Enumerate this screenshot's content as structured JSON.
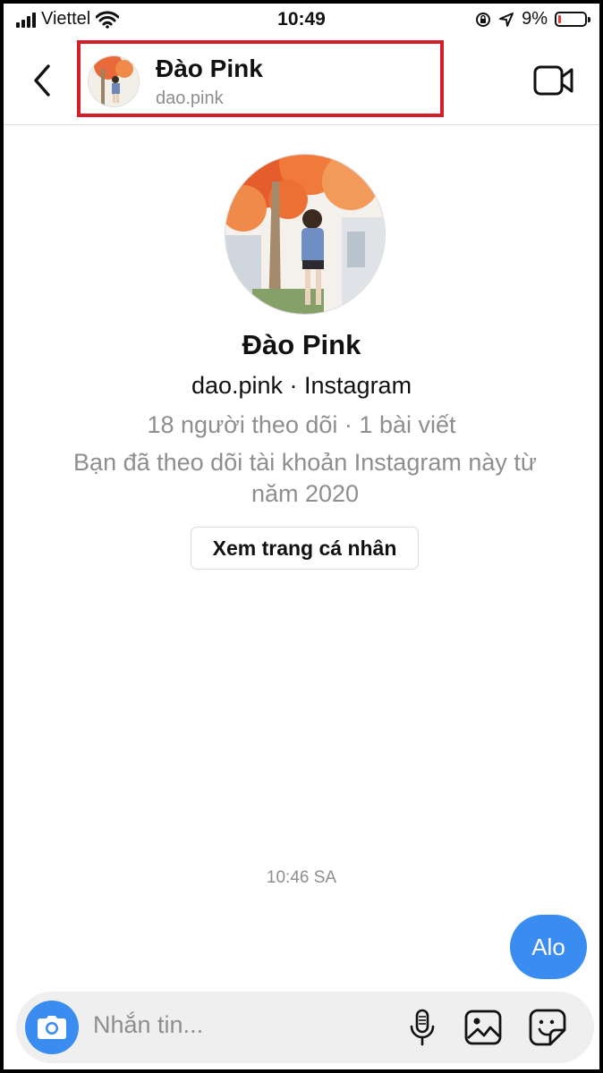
{
  "status_bar": {
    "carrier": "Viettel",
    "time": "10:49",
    "battery": "9%",
    "battery_level": 0.09
  },
  "header": {
    "name": "Đào Pink",
    "username": "dao.pink"
  },
  "profile": {
    "name": "Đào Pink",
    "subtitle": "dao.pink · Instagram",
    "stats": "18 người theo dõi · 1 bài viết",
    "note": "Bạn đã theo dõi tài khoản Instagram này từ năm 2020",
    "view_button": "Xem trang cá nhân"
  },
  "chat": {
    "timestamp": "10:46 SA",
    "messages": [
      {
        "text": "Alo",
        "sent": true
      }
    ]
  },
  "composer": {
    "placeholder": "Nhắn tin...",
    "icons": [
      "camera-icon",
      "microphone-icon",
      "gallery-icon",
      "sticker-icon"
    ]
  },
  "colors": {
    "accent": "#3a8cf0",
    "highlight": "#d41f2b",
    "muted": "#8e8e8e"
  }
}
